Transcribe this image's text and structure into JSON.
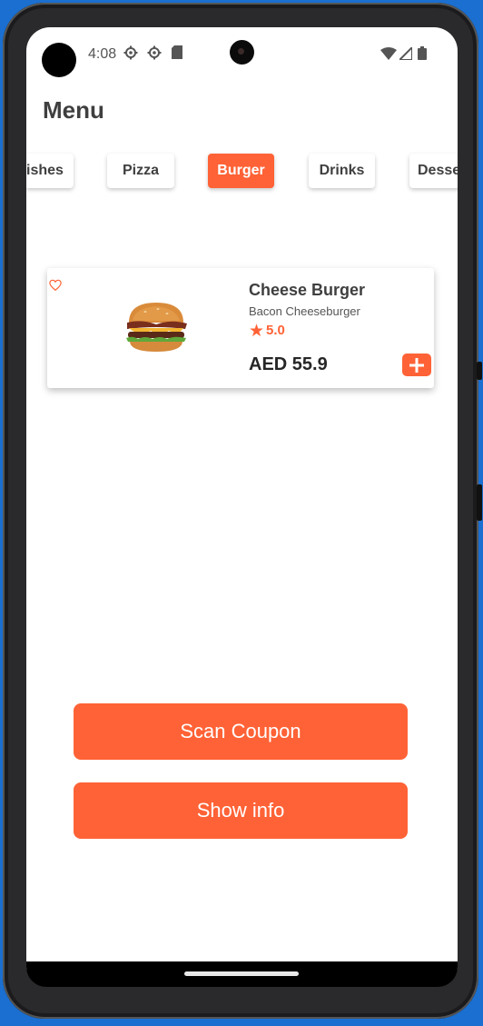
{
  "status_bar": {
    "time": "4:08",
    "left_icons": [
      "settings-icon",
      "settings-icon",
      "sd-card-icon"
    ],
    "right_icons": [
      "wifi-icon",
      "signal-icon",
      "battery-icon"
    ]
  },
  "header": {
    "title": "Menu"
  },
  "categories": [
    {
      "label": "ishes",
      "active": false
    },
    {
      "label": "Pizza",
      "active": false
    },
    {
      "label": "Burger",
      "active": true
    },
    {
      "label": "Drinks",
      "active": false
    },
    {
      "label": "Desse",
      "active": false
    }
  ],
  "menu_items": [
    {
      "name": "Cheese Burger",
      "description": "Bacon Cheeseburger",
      "rating": "5.0",
      "price": "AED 55.9",
      "favorite_icon": "heart-outline-icon",
      "add_icon": "plus-icon"
    }
  ],
  "actions": {
    "scan_coupon": "Scan Coupon",
    "show_info": "Show info"
  },
  "colors": {
    "accent": "#ff6236",
    "text": "#3f3f3f",
    "background": "#ffffff"
  }
}
